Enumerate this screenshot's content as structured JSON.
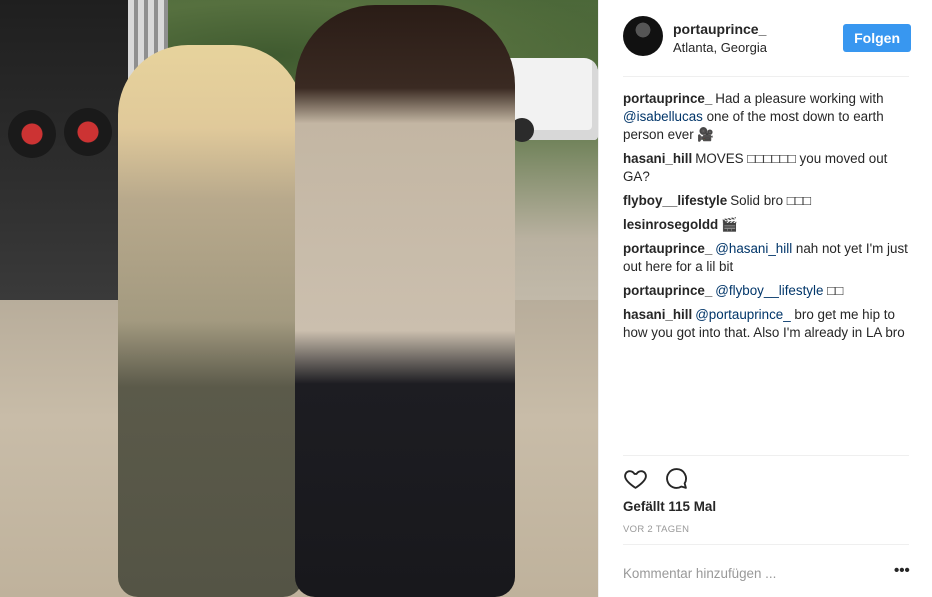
{
  "post": {
    "photo_alt": "",
    "header": {
      "username": "portauprince_",
      "location": "Atlanta, Georgia",
      "follow_label": "Folgen"
    },
    "comments": [
      {
        "user": "portauprince_",
        "parts": [
          {
            "text": "Had a pleasure working with "
          },
          {
            "text": "@isabellucas",
            "mention": true
          },
          {
            "text": " one of the most down to earth person ever 🎥"
          }
        ]
      },
      {
        "user": "hasani_hill",
        "parts": [
          {
            "text": "MOVES □□□□□□ you moved out GA?"
          }
        ]
      },
      {
        "user": "flyboy__lifestyle",
        "parts": [
          {
            "text": "Solid bro □□□"
          }
        ]
      },
      {
        "user": "lesinrosegoldd",
        "parts": [
          {
            "text": "🎬"
          }
        ]
      },
      {
        "user": "portauprince_",
        "parts": [
          {
            "text": "@hasani_hill",
            "mention": true
          },
          {
            "text": " nah not yet I'm just out here for a lil bit"
          }
        ]
      },
      {
        "user": "portauprince_",
        "parts": [
          {
            "text": "@flyboy__lifestyle",
            "mention": true
          },
          {
            "text": " □□"
          }
        ]
      },
      {
        "user": "hasani_hill",
        "parts": [
          {
            "text": "@portauprince_",
            "mention": true
          },
          {
            "text": " bro get me hip to how you got into that. Also I'm already in LA bro"
          }
        ]
      }
    ],
    "actions": {
      "like_icon": "heart-icon",
      "comment_icon": "comment-bubble-icon"
    },
    "likes_text": "Gefällt 115 Mal",
    "time_text": "VOR 2 TAGEN",
    "comment_input": {
      "placeholder": "Kommentar hinzufügen ...",
      "value": ""
    },
    "more_label": "•••",
    "colors": {
      "follow_button": "#3897f0",
      "mention": "#003569",
      "muted": "#999999",
      "divider": "#efefef"
    }
  }
}
